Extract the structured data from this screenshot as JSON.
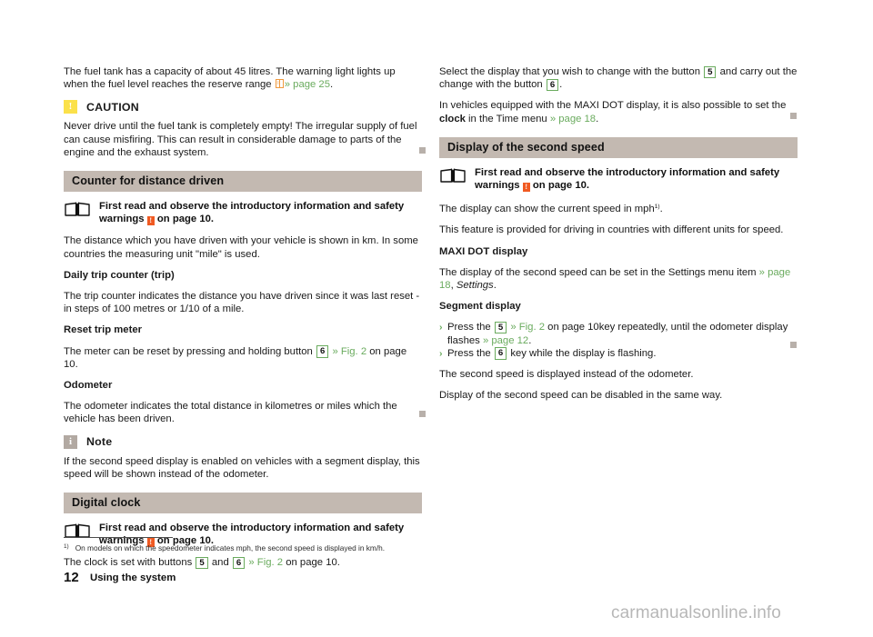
{
  "document": {
    "page_number": "12",
    "page_title": "Using the system",
    "watermark": "carmanualsonline.info"
  },
  "left_column": {
    "intro_paragraph": {
      "text_before": "The fuel tank has a capacity of about 45 litres. The warning light lights up when the fuel level reaches the reserve range ",
      "icon": "display-icon",
      "reference": "» page 25",
      "text_after": "."
    },
    "caution": {
      "badge_glyph": "!",
      "label": "CAUTION",
      "body": "Never drive until the fuel tank is completely empty! The irregular supply of fuel can cause misfiring. This can result in considerable damage to parts of the engine and the exhaust system."
    },
    "section_counter": {
      "heading": "Counter for distance driven",
      "safety_prefix": "First read and observe the introductory information and safety warnings ",
      "safety_suffix": " on page 10.",
      "paragraph_1": "The distance which you have driven with your vehicle is shown in km. In some countries the measuring unit \"mile\" is used.",
      "daily_trip": {
        "lead": "Daily trip counter (trip)",
        "body": "The trip counter indicates the distance you have driven since it was last reset - in steps of 100 metres or 1/10 of a mile."
      },
      "reset_trip": {
        "lead": "Reset trip meter",
        "body_before": "The meter can be reset by pressing and holding button ",
        "key": "6",
        "reference": "» Fig. 2",
        "body_after": " on page 10."
      },
      "odometer": {
        "lead": "Odometer",
        "body": "The odometer indicates the total distance in kilometres or miles which the vehicle has been driven."
      }
    },
    "note": {
      "badge_glyph": "i",
      "label": "Note",
      "body": "If the second speed display is enabled on vehicles with a segment display, this speed will be shown instead of the odometer."
    },
    "section_clock": {
      "heading": "Digital clock",
      "safety_prefix": "First read and observe the introductory information and safety warnings ",
      "safety_suffix": " on page 10.",
      "clock_set": {
        "before": "The clock is set with buttons ",
        "key_1": "5",
        "middle": " and ",
        "key_2": "6",
        "reference": "» Fig. 2",
        "after": " on page 10."
      }
    },
    "footnote": {
      "marker": "1)",
      "text": "On models on which the speedometer indicates mph, the second speed is displayed in km/h."
    }
  },
  "right_column": {
    "select_display": {
      "before": "Select the display that you wish to change with the button ",
      "key_1": "5",
      "middle": " and carry out the change with the button ",
      "key_2": "6",
      "after": "."
    },
    "maxi_dot_clock": {
      "before": "In vehicles equipped with the MAXI DOT display, it is also possible to set the ",
      "bold": "clock",
      "middle": " in the Time menu ",
      "reference": "» page 18",
      "after": "."
    },
    "section_second_speed": {
      "heading": "Display of the second speed",
      "safety_prefix": "First read and observe the introductory information and safety warnings ",
      "safety_suffix": " on page 10.",
      "paragraph_1_before": "The display can show the current speed in mph",
      "paragraph_1_sup": "1)",
      "paragraph_1_after": ".",
      "paragraph_2": "This feature is provided for driving in countries with different units for speed.",
      "maxi_dot": {
        "lead": "MAXI DOT display",
        "body_before": "The display of the second speed can be set in the Settings menu item ",
        "reference": "» page 18",
        "body_middle": ", ",
        "italic": "Settings",
        "body_after": "."
      },
      "segment": {
        "lead": "Segment display",
        "bullet_1": {
          "before": "Press the ",
          "key": "5",
          "reference_1": "» Fig. 2",
          "middle": " on page 10key repeatedly, until the odometer display flashes ",
          "reference_2": "» page 12",
          "after": "."
        },
        "bullet_2": {
          "before": "Press the ",
          "key": "6",
          "after": " key while the display is flashing."
        }
      },
      "paragraph_3": "The second speed is displayed instead of the odometer.",
      "paragraph_4": "Display of the second speed can be disabled in the same way."
    }
  },
  "colors": {
    "section_header_bg": "#c3b9b1",
    "reference_green": "#6aab5e",
    "caution_yellow": "#fbe14a",
    "note_grey": "#b2a9a2",
    "inline_orange": "#f05a22",
    "endmark_grey": "#b8b0aa"
  }
}
